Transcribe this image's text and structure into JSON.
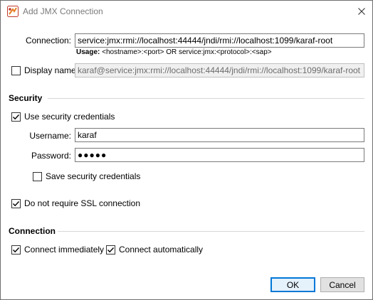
{
  "window": {
    "title": "Add JMX Connection"
  },
  "connection": {
    "label": "Connection:",
    "value": "service:jmx:rmi://localhost:44444/jndi/rmi://localhost:1099/karaf-root",
    "usage_prefix": "Usage:",
    "usage_text": "<hostname>:<port> OR service:jmx:<protocol>:<sap>"
  },
  "display_name": {
    "label": "Display name:",
    "checked": false,
    "value": "karaf@service:jmx:rmi://localhost:44444/jndi/rmi://localhost:1099/karaf-root"
  },
  "security": {
    "heading": "Security",
    "use_credentials_label": "Use security credentials",
    "use_credentials_checked": true,
    "username_label": "Username:",
    "username_value": "karaf",
    "password_label": "Password:",
    "password_mask": "●●●●●",
    "save_credentials_label": "Save security credentials",
    "save_credentials_checked": false,
    "no_ssl_label": "Do not require SSL connection",
    "no_ssl_checked": true
  },
  "connection_section": {
    "heading": "Connection",
    "connect_immediately_label": "Connect immediately",
    "connect_immediately_checked": true,
    "connect_auto_label": "Connect automatically",
    "connect_auto_checked": true
  },
  "buttons": {
    "ok": "OK",
    "cancel": "Cancel"
  }
}
